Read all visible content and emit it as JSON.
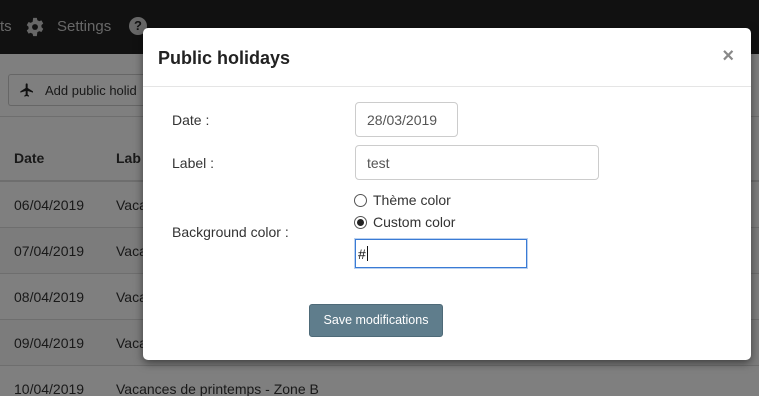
{
  "topbar": {
    "nav_fragment": "ts",
    "settings_label": "Settings",
    "help_label": "?"
  },
  "toolbar": {
    "add_label": "Add public holid"
  },
  "table": {
    "headers": [
      "Date",
      "Lab"
    ],
    "rows": [
      {
        "date": "06/04/2019",
        "label": "Vaca"
      },
      {
        "date": "07/04/2019",
        "label": "Vaca"
      },
      {
        "date": "08/04/2019",
        "label": "Vaca"
      },
      {
        "date": "09/04/2019",
        "label": "Vaca"
      },
      {
        "date": "10/04/2019",
        "label": "Vacances de printemps - Zone B"
      }
    ]
  },
  "modal": {
    "title": "Public holidays",
    "close_glyph": "×",
    "date_label": "Date :",
    "date_value": "28/03/2019",
    "label_label": "Label :",
    "label_value": "test",
    "bg_label": "Background color :",
    "theme_option": "Thème color",
    "custom_option": "Custom color",
    "selected_option": "Custom color",
    "hex_value": "#",
    "save_label": "Save modifications"
  },
  "colors": {
    "topbar": "#222222",
    "save_button": "#5f7d8c",
    "focus_border": "#3a7bd5"
  },
  "icons": {
    "gear": "gear-icon",
    "help": "question-circle-icon",
    "plane": "plane-icon",
    "close": "close-icon"
  }
}
